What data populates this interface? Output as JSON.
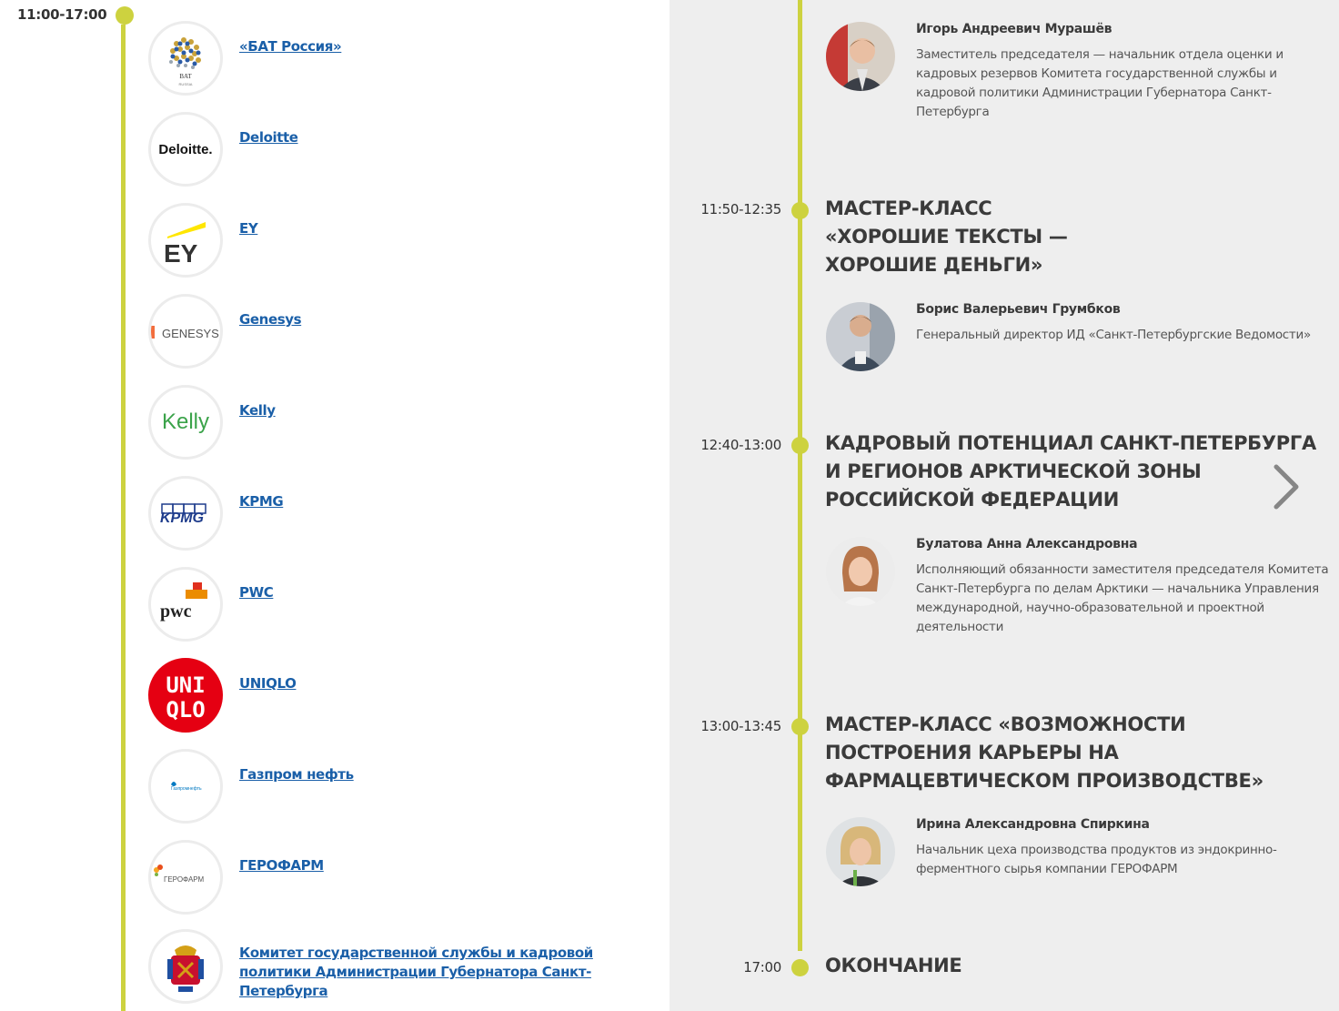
{
  "left": {
    "time": "11:00-17:00",
    "companies": [
      {
        "name": "«БАТ Россия»",
        "logo": "bat-russia-logo"
      },
      {
        "name": "Deloitte",
        "logo": "deloitte-logo"
      },
      {
        "name": "EY",
        "logo": "ey-logo"
      },
      {
        "name": "Genesys",
        "logo": "genesys-logo"
      },
      {
        "name": "Kelly",
        "logo": "kelly-logo"
      },
      {
        "name": "KPMG",
        "logo": "kpmg-logo"
      },
      {
        "name": "PWC",
        "logo": "pwc-logo"
      },
      {
        "name": "UNIQLO",
        "logo": "uniqlo-logo"
      },
      {
        "name": "Газпром нефть",
        "logo": "gazprom-neft-logo"
      },
      {
        "name": "ГЕРОФАРМ",
        "logo": "geropharm-logo"
      },
      {
        "name": "Комитет государственной службы и кадровой политики Администрации Губернатора Санкт-Петербурга",
        "logo": "spb-coat-of-arms"
      }
    ],
    "logo_text": {
      "bat": "BAT",
      "bat_sub": "RUSSIA",
      "deloitte": "Deloitte.",
      "ey": "EY",
      "genesys": "GENESYS",
      "kelly": "Kelly",
      "kpmg": "KPMG",
      "pwc": "pwc",
      "uniqlo_1": "UNI",
      "uniqlo_2": "QLO",
      "gazprom": "Газпромнефть",
      "geropharm": "ГЕРОФАРМ"
    }
  },
  "right": {
    "sessions": [
      {
        "time": "11:50-12:35",
        "title": "Мастер-класс «Хорошие тексты — хорошие деньги»"
      },
      {
        "time": "12:40-13:00",
        "title": "Кадровый потенциал Санкт-Петербурга и регионов Арктической зоны Российской Федерации"
      },
      {
        "time": "13:00-13:45",
        "title": "Мастер-класс «Возможности построения карьеры на фармацевтическом производстве»"
      },
      {
        "time": "17:00",
        "title": "Окончание"
      }
    ],
    "speakers": [
      {
        "name": "Игорь Андреевич Мурашёв",
        "role": "Заместитель председателя — начальник отдела оценки и кадровых резервов Комитета государственной службы и кадровой политики Администрации Губернатора Санкт-Петербурга"
      },
      {
        "name": "Борис Валерьевич Грумбков",
        "role": "Генеральный директор ИД «Санкт-Петербургские Ведомости»"
      },
      {
        "name": "Булатова Анна Александровна",
        "role": "Исполняющий обязанности заместителя председателя Комитета Санкт-Петербурга по делам Арктики — начальника Управления международной, научно-образовательной и проектной деятельности"
      },
      {
        "name": "Ирина Александровна Спиркина",
        "role": "Начальник цеха производства продуктов из эндокринно-ферментного сырья компании ГЕРОФАРМ"
      }
    ]
  },
  "colors": {
    "accent": "#cdd23f",
    "link": "#1a5fa8",
    "panel_bg": "#eeeeee"
  }
}
